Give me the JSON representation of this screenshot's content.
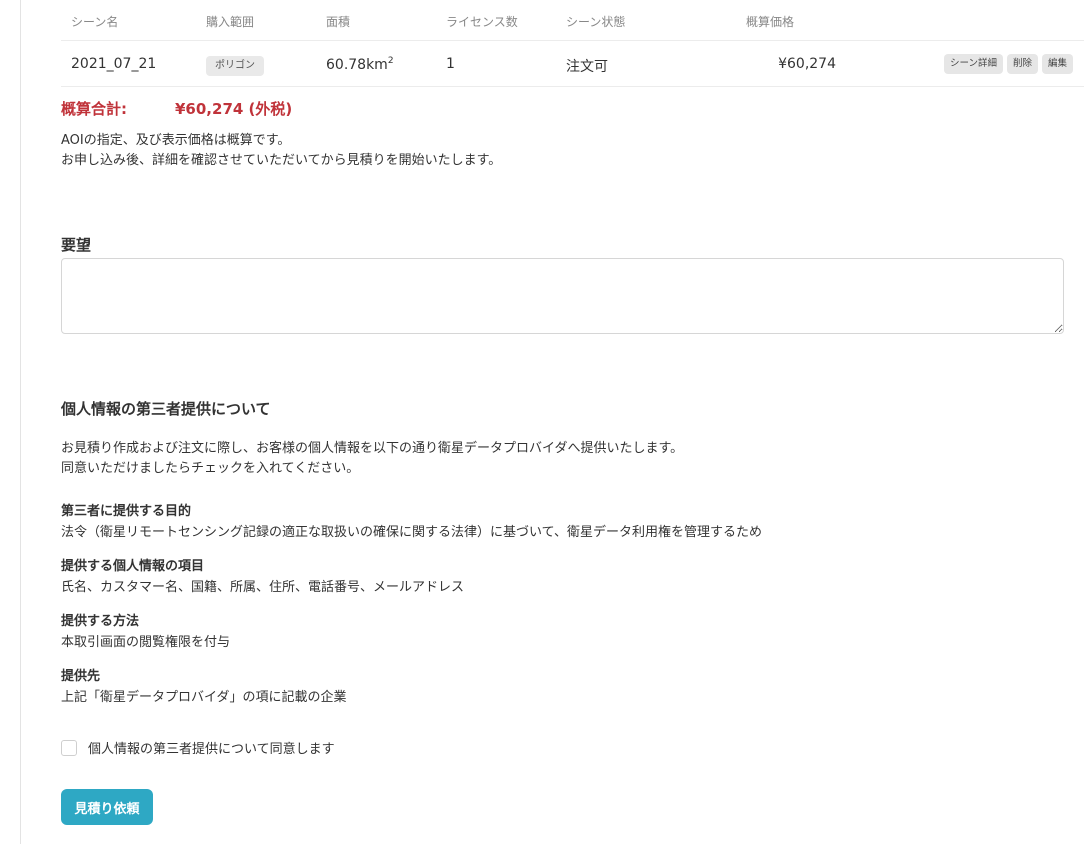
{
  "table": {
    "headers": [
      "シーン名",
      "購入範囲",
      "面積",
      "ライセンス数",
      "シーン状態",
      "概算価格"
    ],
    "rows": [
      {
        "scene_name": "2021_07_21",
        "purchase_range": "ポリゴン",
        "area_value": "60.78km",
        "area_exp": "2",
        "licenses": "1",
        "status": "注文可",
        "price": "¥60,274",
        "actions": [
          "シーン詳細",
          "削除",
          "編集"
        ]
      }
    ]
  },
  "summary": {
    "total_label": "概算合計:",
    "total_value": "¥60,274 (外税)",
    "note_lines": [
      "AOIの指定、及び表示価格は概算です。",
      "お申し込み後、詳細を確認させていただいてから見積りを開始いたします。"
    ]
  },
  "request": {
    "title": "要望",
    "value": "",
    "placeholder": ""
  },
  "privacy": {
    "title": "個人情報の第三者提供について",
    "intro_lines": [
      "お見積り作成および注文に際し、お客様の個人情報を以下の通り衛星データプロバイダへ提供いたします。",
      "同意いただけましたらチェックを入れてください。"
    ],
    "items": [
      {
        "title": "第三者に提供する目的",
        "body": "法令（衛星リモートセンシング記録の適正な取扱いの確保に関する法律）に基づいて、衛星データ利用権を管理するため"
      },
      {
        "title": "提供する個人情報の項目",
        "body": "氏名、カスタマー名、国籍、所属、住所、電話番号、メールアドレス"
      },
      {
        "title": "提供する方法",
        "body": "本取引画面の閲覧権限を付与"
      },
      {
        "title": "提供先",
        "body": "上記「衛星データプロバイダ」の項に記載の企業"
      }
    ],
    "consent_label": "個人情報の第三者提供について同意します",
    "consent_checked": false
  },
  "submit_label": "見積り依頼",
  "colors": {
    "accent": "#2ea8c4",
    "total_red": "#c0333a"
  }
}
